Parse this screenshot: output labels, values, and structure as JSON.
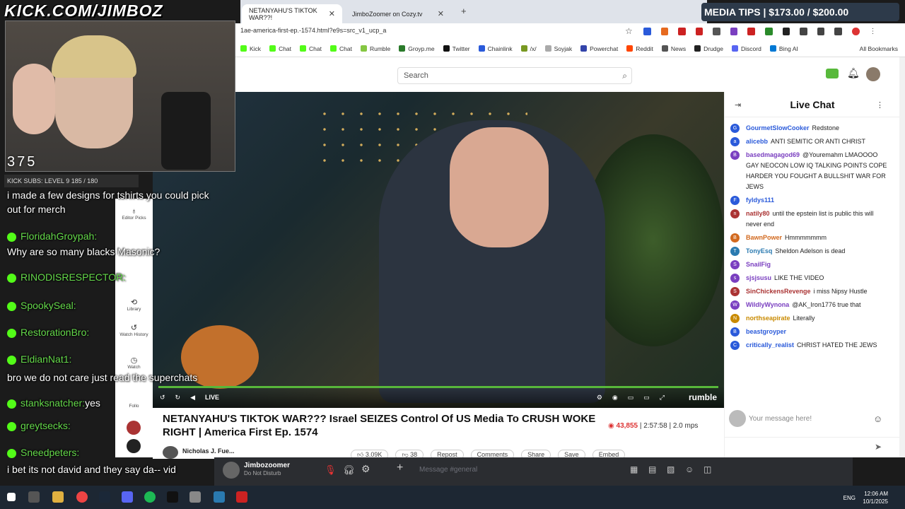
{
  "stream_overlay": {
    "url_banner": "KICK.COM/JIMBOZ",
    "media_tips": "MEDIA TIPS | $173.00 / $200.00",
    "viewer_count": "375",
    "kick_subs": "KICK SUBS: LEVEL 9  185 / 180",
    "chat": [
      {
        "name": "",
        "text": "i made a few designs for tshirts you could pick"
      },
      {
        "name": "",
        "text": "out for merch"
      },
      {
        "name": "FloridahGroypah:",
        "text": ""
      },
      {
        "name": "",
        "text": "Why are so many blacks Masonic?"
      },
      {
        "name": "RINODISRESPECTOR:",
        "text": ""
      },
      {
        "name": "SpookySeal:",
        "text": ""
      },
      {
        "name": "RestorationBro:",
        "text": ""
      },
      {
        "name": "EldianNat1:",
        "text": ""
      },
      {
        "name": "",
        "text": "bro we do not care just read the superchats"
      },
      {
        "name": "stanksnatcher:",
        "text": "yes"
      },
      {
        "name": "greytsecks:",
        "text": ""
      },
      {
        "name": "Sneedpeters:",
        "text": ""
      },
      {
        "name": "",
        "text": "i bet its not david and they say da-- vid"
      }
    ]
  },
  "browser": {
    "tabs": [
      {
        "label": "NETANYAHU'S TIKTOK WAR??!"
      },
      {
        "label": "JimboZoomer on Cozy.tv"
      }
    ],
    "url": "1ae-america-first-ep.-1574.html?e9s=src_v1_ucp_a",
    "bookmarks": [
      {
        "label": "Kick",
        "color": "#53fc18"
      },
      {
        "label": "Chat",
        "color": "#53fc18"
      },
      {
        "label": "Chat",
        "color": "#53fc18"
      },
      {
        "label": "Chat",
        "color": "#53fc18"
      },
      {
        "label": "Rumble",
        "color": "#85c742"
      },
      {
        "label": "Groyp.me",
        "color": "#2a7a2a"
      },
      {
        "label": "Twitter",
        "color": "#111111"
      },
      {
        "label": "Chainlink",
        "color": "#2a5ada"
      },
      {
        "label": "/x/",
        "color": "#789922"
      },
      {
        "label": "Soyjak",
        "color": "#aaaaaa"
      },
      {
        "label": "Powerchat",
        "color": "#3344aa"
      },
      {
        "label": "Reddit",
        "color": "#ff4500"
      },
      {
        "label": "News",
        "color": "#555555"
      },
      {
        "label": "Drudge",
        "color": "#222222"
      },
      {
        "label": "Discord",
        "color": "#5865f2"
      },
      {
        "label": "Bing AI",
        "color": "#0078d4"
      }
    ],
    "all_bookmarks": "All Bookmarks"
  },
  "page": {
    "search_placeholder": "Search",
    "sidebar": [
      {
        "label": "Editor Picks",
        "icon": "award-icon"
      },
      {
        "label": "Library",
        "icon": "library-icon"
      },
      {
        "label": "Watch History",
        "icon": "history-icon"
      },
      {
        "label": "Watch",
        "icon": "watch-icon"
      },
      {
        "label": "Follo",
        "icon": "follow-icon"
      }
    ],
    "video": {
      "live_label": "LIVE",
      "brand": "rumble",
      "title": "NETANYAHU'S TIKTOK WAR??? Israel SEIZES Control Of US Media To CRUSH WOKE RIGHT | America First Ep. 1574",
      "views": "43,855",
      "duration": "2:57:58",
      "bitrate": "2.0 mps",
      "channel": "Nicholas J. Fue...",
      "likes": "3.09K",
      "dislikes": "38",
      "actions": [
        "Repost",
        "Comments",
        "Share",
        "Save",
        "Embed"
      ]
    }
  },
  "live_chat": {
    "title": "Live Chat",
    "input_placeholder": "Your message here!",
    "messages": [
      {
        "user": "GourmetSlowCooker",
        "text": "Redstone",
        "color": "#2a5ada",
        "initial": "G"
      },
      {
        "user": "alicebb",
        "text": "ANTI SEMITIC OR ANTI CHRIST",
        "color": "#2a5ada",
        "initial": "a"
      },
      {
        "user": "basedmagagod69",
        "text": "@Youremahm LMAOOOO GAY NEOCON LOW IQ TALKING POINTS COPE HARDER YOU FOUGHT A BULLSHIT WAR FOR JEWS",
        "color": "#7a3fc0",
        "initial": "B"
      },
      {
        "user": "fyldys111",
        "text": "",
        "color": "#2a5ada",
        "initial": "F"
      },
      {
        "user": "natily80",
        "text": "until the epstein list is public this will never end",
        "color": "#a33",
        "initial": "n"
      },
      {
        "user": "BawnPower",
        "text": "Hmmmmmmm",
        "color": "#d2691e",
        "initial": "B"
      },
      {
        "user": "TonyEsq",
        "text": "Sheldon Adelson is dead",
        "color": "#2a7ab0",
        "initial": "T"
      },
      {
        "user": "SnailFig",
        "text": "",
        "color": "#7a3fc0",
        "initial": "S"
      },
      {
        "user": "sjsjsusu",
        "text": "LIKE THE VIDEO",
        "color": "#7a3fc0",
        "initial": "s"
      },
      {
        "user": "SinChickensRevenge",
        "text": "i miss Nipsy Hustle",
        "color": "#a33",
        "initial": "S"
      },
      {
        "user": "WildlyWynona",
        "text": "@AK_Iron1776 true that",
        "color": "#7a3fc0",
        "initial": "W"
      },
      {
        "user": "northseapirate",
        "text": "Literally",
        "color": "#c98a00",
        "initial": "N"
      },
      {
        "user": "beastgroyper",
        "text": "",
        "color": "#2a5ada",
        "initial": "B"
      },
      {
        "user": "critically_realist",
        "text": "CHRIST HATED THE JEWS",
        "color": "#2a5ada",
        "initial": "C"
      }
    ]
  },
  "discord": {
    "username": "Jimbozoomer",
    "status": "Do Not Disturb",
    "message_placeholder": "Message #general"
  },
  "taskbar": {
    "lang": "ENG",
    "time": "12:06 AM",
    "date": "10/1/2025"
  }
}
